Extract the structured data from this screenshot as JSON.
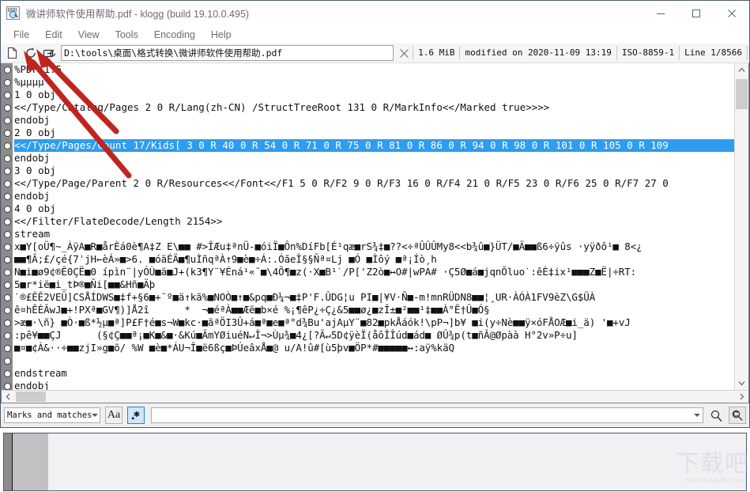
{
  "window": {
    "title": "微讲师软件使用帮助.pdf - klogg (build 19.10.0.495)",
    "app_icon": "klogg-app-icon",
    "controls": {
      "minimize": "minimize-icon",
      "maximize": "maximize-icon",
      "close": "close-icon"
    }
  },
  "menubar": {
    "items": [
      {
        "label": "File"
      },
      {
        "label": "Edit"
      },
      {
        "label": "View"
      },
      {
        "label": "Tools"
      },
      {
        "label": "Encoding"
      },
      {
        "label": "Help"
      }
    ]
  },
  "toolbar": {
    "open_icon": "open-file-icon",
    "reload_icon": "reload-icon",
    "follow_icon": "follow-file-icon",
    "path_value": "D:\\tools\\桌面\\格式转换\\微讲师软件使用帮助.pdf",
    "path_placeholder": "",
    "stop_icon": "stop-icon",
    "status": {
      "size": "1.6 MiB",
      "modified": "modified on 2020-11-09 13:19",
      "encoding": "ISO-8859-1",
      "line": "Line 1/8566"
    }
  },
  "logview": {
    "selected_index": 6,
    "lines": [
      "%PDF-1.5",
      "%µµµµ",
      "1 0 obj",
      "<</Type/Catalog/Pages 2 0 R/Lang(zh-CN) /StructTreeRoot 131 0 R/MarkInfo<</Marked true>>>>",
      "endobj",
      "2 0 obj",
      "<</Type/Pages/Count 17/Kids[ 3 0 R 40 0 R 54 0 R 71 0 R 75 0 R 81 0 R 86 0 R 94 0 R 98 0 R 101 0 R 105 0 R 109",
      "endobj",
      "3 0 obj",
      "<</Type/Page/Parent 2 0 R/Resources<</Font<</F1 5 0 R/F2 9 0 R/F3 16 0 R/F4 21 0 R/F5 23 0 R/F6 25 0 R/F7 27 0",
      "endobj",
      "4 0 obj",
      "<</Filter/FlateDecode/Length 2154>>",
      "stream",
      "x■Y[oÜ¶~_ÀÿA■R■årÈá0è¶A‡Z E\\■■ #>ÎÆu‡ªnÜ-■óiÏ■Ôn%DíFb[É¹qæ■rS¾‡■??<÷ªÛÛÛMy8<<b¾û■}ÜT/■Ä■■ß6÷ÿûs ·yÿðô¹■ 8<¿",
      "■■¶Ã;£/çé{7ˈjH←èÁ»■>6. ■óäÉÄ■¶uÌñqªÀ↑9■è■÷Á:.ÓãeÎ§§Ñª¤Lj ■Ó ■Ìôý ■ª¡Íò¸h",
      "N■i■ø9¢®Ê0ÇË■0 ípìn¨|yÓÙ■ä■J+(k3¶Y¨¥Éná¹«¯■\\4Õ¶■z(·X■B¹ˋ/P['Z2ò■↔O#|wPA# ·Ç5Ø■á■jqnÕluoˋ:êÈ‡ix¹■■■Z■Ë|÷RT:",
      "5■r*ië■i_tÞ®■Ñi[■■&Hñ■Äþ",
      "ˋ®£ÊÊ2VEÛ]CSÅÍDWS■‡f+§6■+¨º■ä↑kã%■NOÒ■↑■&pq■Ð¼¬■‡P'F.ÛDG¦u PI■|¥V·Ñ■-m!mnRÜDN8■■¦¸UR·ÀÓÀ1FV9èZ\\G$ÜÀ",
      "ê¤hÊÈÂwJ■+!PXª■GV¶)]Å2î      *  ¬■éªÀ■■Æë■b×é %¡¶êP¿÷Ç¿&5■■ø¿■zÎ±■²■■¹‡■■À°Ë†Û■Ó§",
      ">æ■·\\ñ} ■Ò·■ß*½µ■ª]P£F†é■s¬W■kc·■ãªÖI3Û+á■ª■e■ª°d¾Bu'ajAµY¨■82■pkÅáók!\\pP¬]b¥ ■i(y÷Nè■■ÿ×óFÅOÆ■i_ä) '■+vJ",
      ":pê¥■■ÇJ      (§¢Ç■■ª¡■K■&■·&Kú■ÃmYØiuéN↵Î¬>Ùµ¾■4¿[?Ä↵5D¢ÿèÏ(åôÎÎúd■ád■ ØÛ¾p(t■ñÂ@Øpàà H°2v»P÷u]",
      "■¤■¢À&··÷■■zjI»g■õ/ %W ■è■*ÁU¬Î■ë6ßç■ÞÚeâxÅ■@ u/A!û#[ù5þv■ÖP*#■■■■■↔:aÿ%käQ",
      "",
      "endstream",
      "endobj"
    ]
  },
  "searchbar": {
    "mode_value": "Marks and matches",
    "case_button_label": "Aa",
    "regex_icon": "regex-asterisk-icon",
    "search_value": "",
    "search_placeholder": "",
    "dropdown_icon": "chevron-down-icon",
    "search_icon": "magnifier-icon",
    "search_again_icon": "search-again-icon"
  },
  "scrollbars": {
    "v_up_icon": "chevron-up-icon",
    "v_down_icon": "chevron-down-icon",
    "h_left_icon": "chevron-left-icon",
    "h_right_icon": "chevron-right-icon"
  },
  "annotations": {
    "arrow1": "red-arrow-to-reload-button",
    "arrow2": "red-arrow-to-follow-button",
    "arrow_color": "#c0241f"
  },
  "watermark": {
    "chars": "下载吧",
    "url": "www.xiazaiba.com"
  }
}
